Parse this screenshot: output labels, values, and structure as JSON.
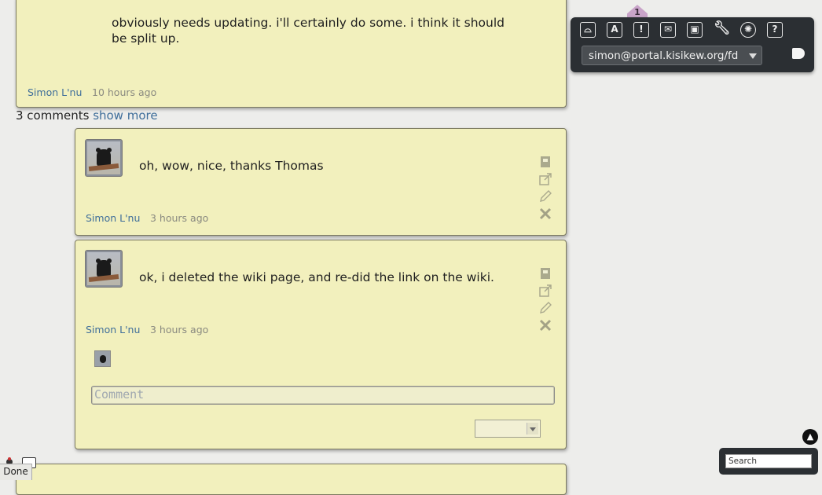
{
  "top_post": {
    "text_line1": "obviously needs updating. i'll certainly do some. i think it should",
    "text_line2": "be split up.",
    "author": "Simon L'nu",
    "time": "10 hours ago"
  },
  "comments_summary": {
    "count_label": "3 comments",
    "show_more": "show more"
  },
  "comments": [
    {
      "text": "oh, wow, nice, thanks Thomas",
      "author": "Simon L'nu",
      "time": "3 hours ago"
    },
    {
      "text": "ok, i deleted the wiki page, and re-did the link on the wiki.",
      "author": "Simon L'nu",
      "time": "3 hours ago"
    }
  ],
  "comment_form": {
    "placeholder": "Comment"
  },
  "toolbar": {
    "badge_count": "1",
    "icons": [
      "network-icon",
      "contacts-icon",
      "notifications-icon",
      "messages-icon",
      "apps-icon",
      "settings-icon",
      "admin-icon",
      "help-icon"
    ],
    "account": "simon@portal.kisikew.org/fd"
  },
  "search": {
    "placeholder": "Search"
  },
  "status_bar": {
    "done": "Done"
  },
  "colors": {
    "card_bg": "#f2f0bd",
    "link": "#3f6e9a",
    "toolbar_bg": "#2b2f33",
    "badge": "#c9a4c9"
  }
}
